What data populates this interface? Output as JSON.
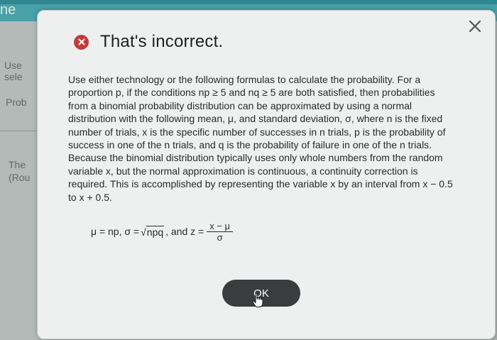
{
  "background": {
    "top_left_fragment": "ne",
    "left_texts": [
      "Use",
      "sele",
      "Prob",
      "The",
      "(Rou"
    ]
  },
  "dialog": {
    "title": "That's incorrect.",
    "body": "Use either technology or the following formulas to calculate the probability. For a proportion p, if the conditions np ≥ 5 and nq ≥ 5 are both satisfied, then probabilities from a binomial probability distribution can be approximated by using a normal distribution with the following mean, μ, and standard deviation, σ, where n is the fixed number of trials, x is the specific number of successes in n trials, p is the probability of success in one of the n trials, and q is the probability of failure in one of the n trials. Because the binomial distribution typically uses only whole numbers from the random variable x, but the normal approximation is continuous, a continuity correction is required. This is accomplished by representing the variable x by an interval from x − 0.5 to x + 0.5.",
    "formula": {
      "mean": "μ = np, σ = ",
      "sqrt_content": "npq",
      "and_z": ", and z = ",
      "numerator": "x − μ",
      "denominator": "σ"
    },
    "ok_label": "OK"
  },
  "colors": {
    "error_icon": "#c23b3b",
    "ok_button": "#3b3c3d",
    "dialog_bg": "#eef0f0",
    "header_teal": "#48a0a8"
  },
  "icons": {
    "close": "close-icon",
    "error": "error-x-circle-icon",
    "cursor": "hand-pointer-icon"
  }
}
